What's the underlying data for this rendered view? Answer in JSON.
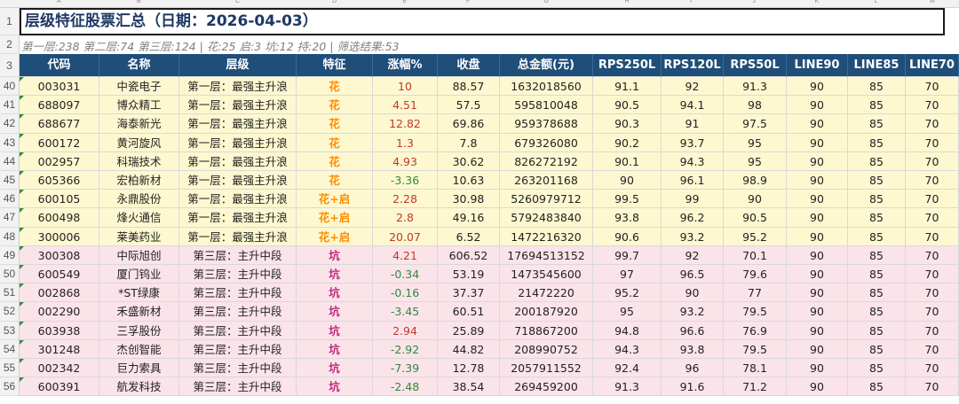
{
  "column_letters": [
    "A",
    "B",
    "C",
    "D",
    "E",
    "F",
    "G",
    "H",
    "I",
    "J",
    "K",
    "L",
    "M"
  ],
  "title": "层级特征股票汇总（日期：2026-04-03）",
  "summary": "第一层:238 第二层:74 第三层:124 | 花:25 启:3 坑:12 持:20 | 筛选结果:53",
  "header_row_number": "3",
  "headers": [
    "代码",
    "名称",
    "层级",
    "特征",
    "涨幅%",
    "收盘",
    "总金额(元)",
    "RPS250L",
    "RPS120L",
    "RPS50L",
    "LINE90",
    "LINE85",
    "LINE70"
  ],
  "colors": {
    "header_bg": "#1f4e79",
    "yellow_row_bg": "#fdf8d0",
    "pink_row_bg": "#fbe3ea",
    "up_red": "#c0392b",
    "down_green": "#2e8b3a",
    "flower_orange": "#ff8c00",
    "pit_magenta": "#c0287a",
    "title_blue": "#1f3864"
  },
  "rows": [
    {
      "row": "40",
      "code": "003031",
      "name": "中瓷电子",
      "level": "第一层：最强主升浪",
      "feature": "花",
      "chg": "10",
      "close": "88.57",
      "amount": "1632018560",
      "rps250": "91.1",
      "rps120": "92",
      "rps50": "91.3",
      "line90": "90",
      "line85": "85",
      "line70": "70",
      "band": "y",
      "dir": "up"
    },
    {
      "row": "41",
      "code": "688097",
      "name": "博众精工",
      "level": "第一层：最强主升浪",
      "feature": "花",
      "chg": "4.51",
      "close": "57.5",
      "amount": "595810048",
      "rps250": "90.5",
      "rps120": "94.1",
      "rps50": "98",
      "line90": "90",
      "line85": "85",
      "line70": "70",
      "band": "y",
      "dir": "up"
    },
    {
      "row": "42",
      "code": "688677",
      "name": "海泰新光",
      "level": "第一层：最强主升浪",
      "feature": "花",
      "chg": "12.82",
      "close": "69.86",
      "amount": "959378688",
      "rps250": "90.3",
      "rps120": "91",
      "rps50": "97.5",
      "line90": "90",
      "line85": "85",
      "line70": "70",
      "band": "y",
      "dir": "up"
    },
    {
      "row": "43",
      "code": "600172",
      "name": "黄河旋风",
      "level": "第一层：最强主升浪",
      "feature": "花",
      "chg": "1.3",
      "close": "7.8",
      "amount": "679326080",
      "rps250": "90.2",
      "rps120": "93.7",
      "rps50": "95",
      "line90": "90",
      "line85": "85",
      "line70": "70",
      "band": "y",
      "dir": "up"
    },
    {
      "row": "44",
      "code": "002957",
      "name": "科瑞技术",
      "level": "第一层：最强主升浪",
      "feature": "花",
      "chg": "4.93",
      "close": "30.62",
      "amount": "826272192",
      "rps250": "90.1",
      "rps120": "94.3",
      "rps50": "95",
      "line90": "90",
      "line85": "85",
      "line70": "70",
      "band": "y",
      "dir": "up"
    },
    {
      "row": "45",
      "code": "605366",
      "name": "宏柏新材",
      "level": "第一层：最强主升浪",
      "feature": "花",
      "chg": "-3.36",
      "close": "10.63",
      "amount": "263201168",
      "rps250": "90",
      "rps120": "96.1",
      "rps50": "98.9",
      "line90": "90",
      "line85": "85",
      "line70": "70",
      "band": "y",
      "dir": "down"
    },
    {
      "row": "46",
      "code": "600105",
      "name": "永鼎股份",
      "level": "第一层：最强主升浪",
      "feature": "花+启",
      "chg": "2.28",
      "close": "30.98",
      "amount": "5260979712",
      "rps250": "99.5",
      "rps120": "99",
      "rps50": "90",
      "line90": "90",
      "line85": "85",
      "line70": "70",
      "band": "y",
      "dir": "up"
    },
    {
      "row": "47",
      "code": "600498",
      "name": "烽火通信",
      "level": "第一层：最强主升浪",
      "feature": "花+启",
      "chg": "2.8",
      "close": "49.16",
      "amount": "5792483840",
      "rps250": "93.8",
      "rps120": "96.2",
      "rps50": "90.5",
      "line90": "90",
      "line85": "85",
      "line70": "70",
      "band": "y",
      "dir": "up"
    },
    {
      "row": "48",
      "code": "300006",
      "name": "莱美药业",
      "level": "第一层：最强主升浪",
      "feature": "花+启",
      "chg": "20.07",
      "close": "6.52",
      "amount": "1472216320",
      "rps250": "90.6",
      "rps120": "93.2",
      "rps50": "95.2",
      "line90": "90",
      "line85": "85",
      "line70": "70",
      "band": "y",
      "dir": "up"
    },
    {
      "row": "49",
      "code": "300308",
      "name": "中际旭创",
      "level": "第三层：主升中段",
      "feature": "坑",
      "chg": "4.21",
      "close": "606.52",
      "amount": "17694513152",
      "rps250": "99.7",
      "rps120": "92",
      "rps50": "70.1",
      "line90": "90",
      "line85": "85",
      "line70": "70",
      "band": "p",
      "dir": "up"
    },
    {
      "row": "50",
      "code": "600549",
      "name": "厦门钨业",
      "level": "第三层：主升中段",
      "feature": "坑",
      "chg": "-0.34",
      "close": "53.19",
      "amount": "1473545600",
      "rps250": "97",
      "rps120": "96.5",
      "rps50": "79.6",
      "line90": "90",
      "line85": "85",
      "line70": "70",
      "band": "p",
      "dir": "down"
    },
    {
      "row": "51",
      "code": "002868",
      "name": "*ST绿康",
      "level": "第三层：主升中段",
      "feature": "坑",
      "chg": "-0.16",
      "close": "37.37",
      "amount": "21472220",
      "rps250": "95.2",
      "rps120": "90",
      "rps50": "77",
      "line90": "90",
      "line85": "85",
      "line70": "70",
      "band": "p",
      "dir": "down"
    },
    {
      "row": "52",
      "code": "002290",
      "name": "禾盛新材",
      "level": "第三层：主升中段",
      "feature": "坑",
      "chg": "-3.45",
      "close": "60.51",
      "amount": "200187920",
      "rps250": "95",
      "rps120": "93.2",
      "rps50": "79.5",
      "line90": "90",
      "line85": "85",
      "line70": "70",
      "band": "p",
      "dir": "down"
    },
    {
      "row": "53",
      "code": "603938",
      "name": "三孚股份",
      "level": "第三层：主升中段",
      "feature": "坑",
      "chg": "2.94",
      "close": "25.89",
      "amount": "718867200",
      "rps250": "94.8",
      "rps120": "96.6",
      "rps50": "76.9",
      "line90": "90",
      "line85": "85",
      "line70": "70",
      "band": "p",
      "dir": "up"
    },
    {
      "row": "54",
      "code": "301248",
      "name": "杰创智能",
      "level": "第三层：主升中段",
      "feature": "坑",
      "chg": "-2.92",
      "close": "44.82",
      "amount": "208990752",
      "rps250": "94.3",
      "rps120": "93.8",
      "rps50": "79.5",
      "line90": "90",
      "line85": "85",
      "line70": "70",
      "band": "p",
      "dir": "down"
    },
    {
      "row": "55",
      "code": "002342",
      "name": "巨力索具",
      "level": "第三层：主升中段",
      "feature": "坑",
      "chg": "-7.39",
      "close": "12.78",
      "amount": "2057911552",
      "rps250": "92.4",
      "rps120": "96",
      "rps50": "78.1",
      "line90": "90",
      "line85": "85",
      "line70": "70",
      "band": "p",
      "dir": "down"
    },
    {
      "row": "56",
      "code": "600391",
      "name": "航发科技",
      "level": "第三层：主升中段",
      "feature": "坑",
      "chg": "-2.48",
      "close": "38.54",
      "amount": "269459200",
      "rps250": "91.3",
      "rps120": "91.6",
      "rps50": "71.2",
      "line90": "90",
      "line85": "85",
      "line70": "70",
      "band": "p",
      "dir": "down"
    }
  ]
}
